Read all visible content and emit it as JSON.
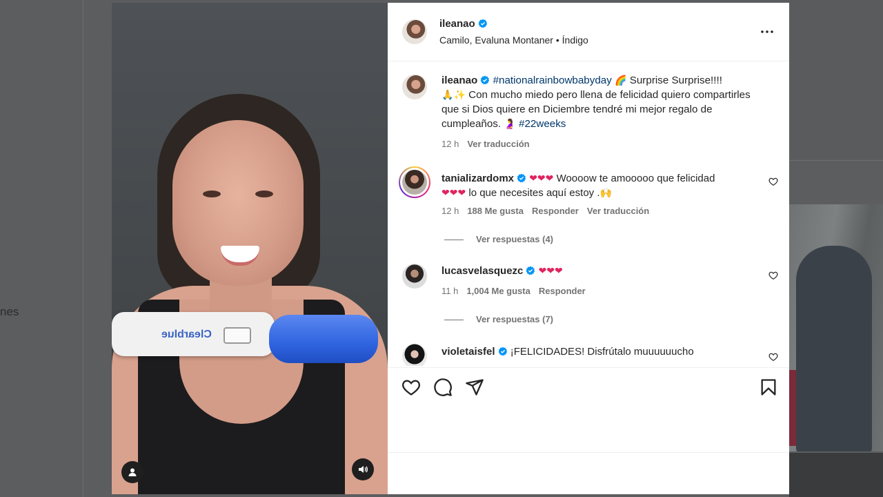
{
  "background": {
    "sidebar_text": "nes"
  },
  "post": {
    "author": "ileanao",
    "audio": "Camilo, Evaluna Montaner • Índigo",
    "caption": {
      "hashtag1": "#nationalrainbowbabyday",
      "text1": " Surprise Surprise!!!!",
      "text2": " Con mucho miedo pero llena de felicidad quiero compartirles que si Dios quiere en Diciembre tendré mi mejor regalo de cumpleaños. ",
      "hashtag2": "#22weeks",
      "time": "12 h",
      "translate": "Ver traducción"
    }
  },
  "comments": [
    {
      "username": "tanializardomx",
      "text_a": " Woooow te amooooo que felicidad ",
      "text_b": " lo que necesites aquí estoy .",
      "time": "12 h",
      "likes": "188 Me gusta",
      "reply": "Responder",
      "translate": "Ver traducción",
      "replies": "Ver respuestas (4)"
    },
    {
      "username": "lucasvelasquezc",
      "time": "11 h",
      "likes": "1,004 Me gusta",
      "reply": "Responder",
      "replies": "Ver respuestas (7)"
    },
    {
      "username": "violetaisfel",
      "text": "¡FELICIDADES! Disfrútalo muuuuuucho"
    }
  ],
  "media": {
    "brand": "Clearblue"
  },
  "colors": {
    "verified": "#0095f6",
    "heart_red": "#e0245e",
    "link_blue": "#00376b"
  }
}
